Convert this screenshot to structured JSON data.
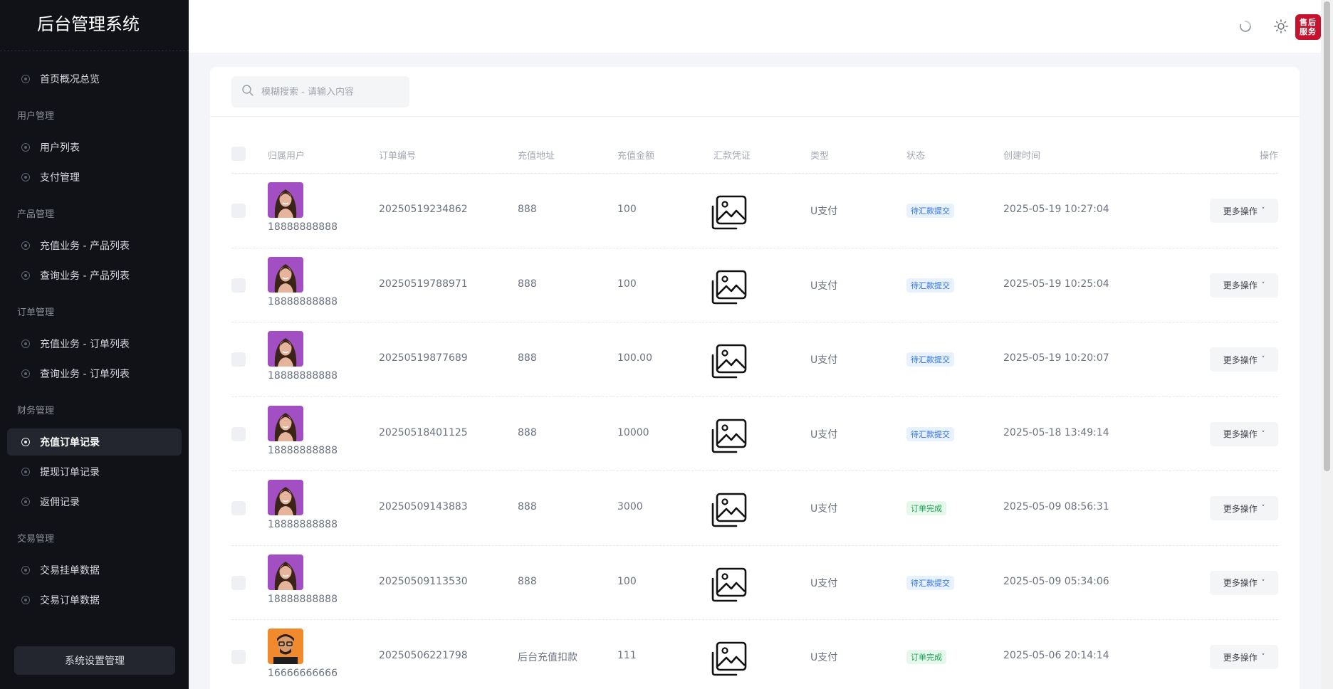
{
  "sidebar": {
    "brand": "后台管理系统",
    "home": "首页概况总览",
    "groups": [
      {
        "title": "用户管理",
        "items": [
          "用户列表",
          "支付管理"
        ]
      },
      {
        "title": "产品管理",
        "items": [
          "充值业务 - 产品列表",
          "查询业务 - 产品列表"
        ]
      },
      {
        "title": "订单管理",
        "items": [
          "充值业务 - 订单列表",
          "查询业务 - 订单列表"
        ]
      },
      {
        "title": "财务管理",
        "items": [
          "充值订单记录",
          "提现订单记录",
          "返佣记录"
        ]
      },
      {
        "title": "交易管理",
        "items": [
          "交易挂单数据",
          "交易订单数据"
        ]
      }
    ],
    "active_item": "充值订单记录",
    "settings_button": "系统设置管理"
  },
  "header": {
    "service_button": "售后服务"
  },
  "search": {
    "placeholder": "模糊搜索 - 请输入内容"
  },
  "table": {
    "columns": {
      "user": "归属用户",
      "order_no": "订单编号",
      "address": "充值地址",
      "amount": "充值金额",
      "voucher": "汇款凭证",
      "type": "类型",
      "status": "状态",
      "created": "创建时间",
      "actions": "操作"
    },
    "more_label": "更多操作",
    "rows": [
      {
        "phone": "18888888888",
        "avatar": "woman",
        "order_no": "20250519234862",
        "address": "888",
        "amount": "100",
        "type": "U支付",
        "status": "待汇款提交",
        "status_kind": "pending",
        "created": "2025-05-19 10:27:04"
      },
      {
        "phone": "18888888888",
        "avatar": "woman",
        "order_no": "20250519788971",
        "address": "888",
        "amount": "100",
        "type": "U支付",
        "status": "待汇款提交",
        "status_kind": "pending",
        "created": "2025-05-19 10:25:04"
      },
      {
        "phone": "18888888888",
        "avatar": "woman",
        "order_no": "20250519877689",
        "address": "888",
        "amount": "100.00",
        "type": "U支付",
        "status": "待汇款提交",
        "status_kind": "pending",
        "created": "2025-05-19 10:20:07"
      },
      {
        "phone": "18888888888",
        "avatar": "woman",
        "order_no": "20250518401125",
        "address": "888",
        "amount": "10000",
        "type": "U支付",
        "status": "待汇款提交",
        "status_kind": "pending",
        "created": "2025-05-18 13:49:14"
      },
      {
        "phone": "18888888888",
        "avatar": "woman",
        "order_no": "20250509143883",
        "address": "888",
        "amount": "3000",
        "type": "U支付",
        "status": "订单完成",
        "status_kind": "done",
        "created": "2025-05-09 08:56:31"
      },
      {
        "phone": "18888888888",
        "avatar": "woman",
        "order_no": "20250509113530",
        "address": "888",
        "amount": "100",
        "type": "U支付",
        "status": "待汇款提交",
        "status_kind": "pending",
        "created": "2025-05-09 05:34:06"
      },
      {
        "phone": "16666666666",
        "avatar": "man",
        "order_no": "20250506221798",
        "address": "后台充值扣款",
        "amount": "111",
        "type": "U支付",
        "status": "订单完成",
        "status_kind": "done",
        "created": "2025-05-06 20:14:14"
      }
    ]
  },
  "colors": {
    "sidebar_bg": "#101217",
    "accent_red": "#c4122f",
    "pending_blue": "#2f6fde",
    "done_green": "#1aa251"
  },
  "icons": [
    "search-icon",
    "loading-icon",
    "sun-icon",
    "image-icon",
    "chevron-down-icon",
    "nav-dot-icon"
  ]
}
